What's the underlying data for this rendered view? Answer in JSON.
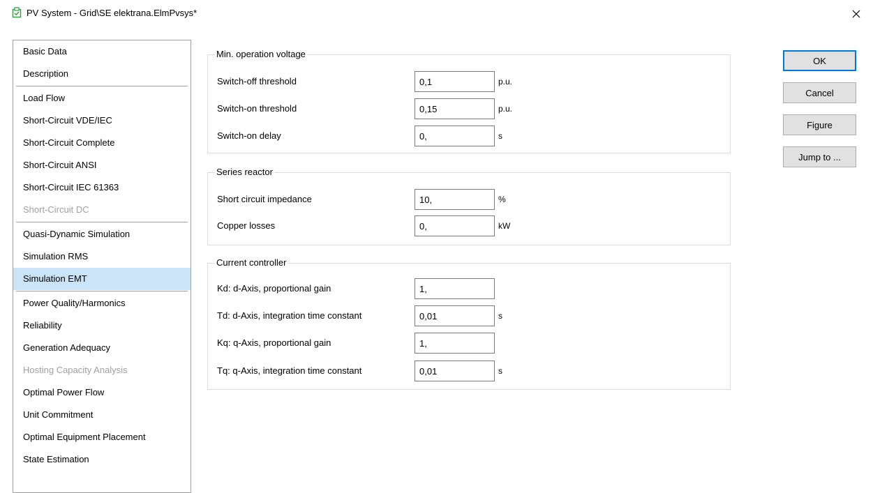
{
  "window": {
    "title": "PV System - Grid\\SE elektrana.ElmPvsys*",
    "icon": "pv-system-icon",
    "close_icon": "close-icon"
  },
  "sidebar": {
    "items": [
      {
        "label": "Basic Data",
        "state": "normal"
      },
      {
        "label": "Description",
        "state": "normal"
      },
      {
        "label": "Load Flow",
        "state": "normal"
      },
      {
        "label": "Short-Circuit VDE/IEC",
        "state": "normal"
      },
      {
        "label": "Short-Circuit Complete",
        "state": "normal"
      },
      {
        "label": "Short-Circuit ANSI",
        "state": "normal"
      },
      {
        "label": "Short-Circuit IEC 61363",
        "state": "normal"
      },
      {
        "label": "Short-Circuit DC",
        "state": "disabled"
      },
      {
        "label": "Quasi-Dynamic Simulation",
        "state": "normal"
      },
      {
        "label": "Simulation RMS",
        "state": "normal"
      },
      {
        "label": "Simulation EMT",
        "state": "selected"
      },
      {
        "label": "Power Quality/Harmonics",
        "state": "normal"
      },
      {
        "label": "Reliability",
        "state": "normal"
      },
      {
        "label": "Generation Adequacy",
        "state": "normal"
      },
      {
        "label": "Hosting Capacity Analysis",
        "state": "disabled"
      },
      {
        "label": "Optimal Power Flow",
        "state": "normal"
      },
      {
        "label": "Unit Commitment",
        "state": "normal"
      },
      {
        "label": "Optimal Equipment Placement",
        "state": "normal"
      },
      {
        "label": "State Estimation",
        "state": "normal"
      }
    ]
  },
  "groups": {
    "min_voltage": {
      "title": "Min. operation voltage",
      "fields": [
        {
          "label": "Switch-off threshold",
          "value": "0,1",
          "unit": "p.u."
        },
        {
          "label": "Switch-on threshold",
          "value": "0,15",
          "unit": "p.u."
        },
        {
          "label": "Switch-on delay",
          "value": "0,",
          "unit": "s"
        }
      ]
    },
    "series_reactor": {
      "title": "Series reactor",
      "fields": [
        {
          "label": "Short circuit impedance",
          "value": "10,",
          "unit": "%"
        },
        {
          "label": "Copper losses",
          "value": "0,",
          "unit": "kW"
        }
      ]
    },
    "current_controller": {
      "title": "Current controller",
      "fields": [
        {
          "label": "Kd: d-Axis, proportional gain",
          "value": "1,",
          "unit": ""
        },
        {
          "label": "Td: d-Axis, integration time constant",
          "value": "0,01",
          "unit": "s"
        },
        {
          "label": "Kq: q-Axis, proportional gain",
          "value": "1,",
          "unit": ""
        },
        {
          "label": "Tq: q-Axis, integration time constant",
          "value": "0,01",
          "unit": "s"
        }
      ]
    }
  },
  "buttons": {
    "ok": "OK",
    "cancel": "Cancel",
    "figure": "Figure",
    "jump_to": "Jump to ..."
  },
  "colors": {
    "selected_bg": "#cce4f7",
    "default_button_border": "#0078d7",
    "disabled_text": "#a0a0a0",
    "icon_green": "#2e9e3c"
  }
}
